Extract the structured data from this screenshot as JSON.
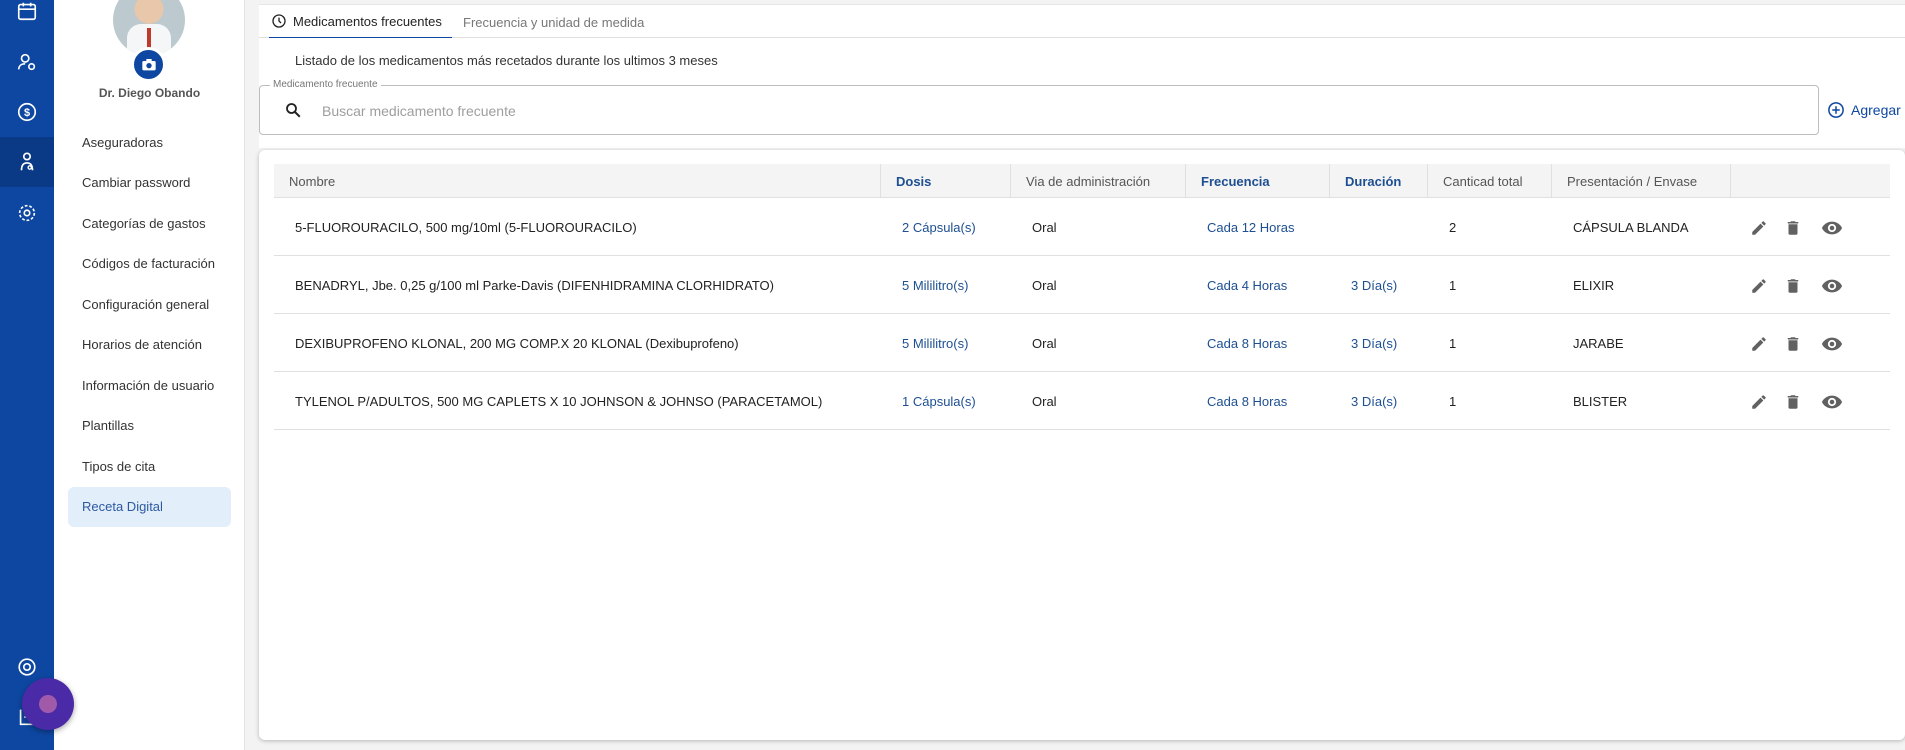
{
  "rail": {
    "items": [
      {
        "icon": "calendar-icon"
      },
      {
        "icon": "patients-icon"
      },
      {
        "icon": "billing-icon"
      },
      {
        "icon": "doctor-icon"
      },
      {
        "icon": "settings-icon"
      }
    ],
    "bottom": [
      {
        "icon": "help-icon"
      },
      {
        "icon": "logout-icon"
      }
    ]
  },
  "profile": {
    "name": "Dr. Diego Obando"
  },
  "menu": {
    "items": [
      {
        "label": "Aseguradoras"
      },
      {
        "label": "Cambiar password"
      },
      {
        "label": "Categorías de gastos"
      },
      {
        "label": "Códigos de facturación"
      },
      {
        "label": "Configuración general"
      },
      {
        "label": "Horarios de atención"
      },
      {
        "label": "Información de usuario"
      },
      {
        "label": "Plantillas"
      },
      {
        "label": "Tipos de cita"
      },
      {
        "label": "Receta Digital"
      }
    ],
    "active_index": 9
  },
  "tabs": [
    {
      "label": "Medicamentos frecuentes",
      "active": true
    },
    {
      "label": "Frecuencia y unidad de medida",
      "active": false
    }
  ],
  "subtitle": "Listado de los medicamentos más recetados durante los ultimos 3 meses",
  "search": {
    "legend": "Medicamento frecuente",
    "placeholder": "Buscar medicamento frecuente",
    "value": ""
  },
  "add_label": "Agregar",
  "table": {
    "headers": [
      {
        "label": "Nombre",
        "sortable": false
      },
      {
        "label": "Dosis",
        "sortable": true
      },
      {
        "label": "Via de administración",
        "sortable": false
      },
      {
        "label": "Frecuencia",
        "sortable": true
      },
      {
        "label": "Duración",
        "sortable": true
      },
      {
        "label": "Canticad total",
        "sortable": false
      },
      {
        "label": "Presentación / Envase",
        "sortable": false
      }
    ],
    "rows": [
      {
        "nombre": "5-FLUOROURACILO, 500 mg/10ml (5-FLUOROURACILO)",
        "dosis": "2 Cápsula(s)",
        "via": "Oral",
        "frecuencia": "Cada 12 Horas",
        "duracion": "",
        "cantidad": "2",
        "presentacion": "CÁPSULA BLANDA"
      },
      {
        "nombre": "BENADRYL, Jbe. 0,25 g/100 ml Parke-Davis (DIFENHIDRAMINA CLORHIDRATO)",
        "dosis": "5 Mililitro(s)",
        "via": "Oral",
        "frecuencia": "Cada 4 Horas",
        "duracion": "3 Día(s)",
        "cantidad": "1",
        "presentacion": "ELIXIR"
      },
      {
        "nombre": "DEXIBUPROFENO KLONAL, 200 MG COMP.X 20 KLONAL (Dexibuprofeno)",
        "dosis": "5 Mililitro(s)",
        "via": "Oral",
        "frecuencia": "Cada 8 Horas",
        "duracion": "3 Día(s)",
        "cantidad": "1",
        "presentacion": "JARABE"
      },
      {
        "nombre": "TYLENOL P/ADULTOS, 500 MG CAPLETS X 10 JOHNSON & JOHNSO (PARACETAMOL)",
        "dosis": "1 Cápsula(s)",
        "via": "Oral",
        "frecuencia": "Cada 8 Horas",
        "duracion": "3 Día(s)",
        "cantidad": "1",
        "presentacion": "BLISTER"
      }
    ],
    "row_actions": [
      "edit-icon",
      "delete-icon",
      "view-icon"
    ]
  },
  "colors": {
    "rail": "#0d47a1",
    "accent": "#1d4f91",
    "active_menu_bg": "#e3eefb"
  }
}
